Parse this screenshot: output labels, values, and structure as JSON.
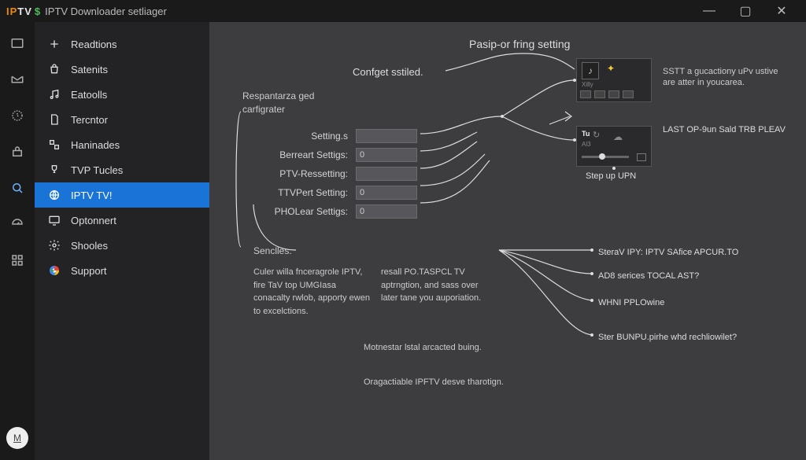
{
  "brand": {
    "iptv": "IPTV",
    "dollar": "$",
    "title": "IPTV Downloader setliager"
  },
  "window_controls": {
    "minimize": "—",
    "maximize": "▢",
    "close": "✕"
  },
  "rail": {
    "items": [
      "browse",
      "mail",
      "history",
      "library",
      "search-active",
      "dashboard",
      "apps"
    ],
    "avatar": "M"
  },
  "sidebar": {
    "items": [
      {
        "icon": "+",
        "label": "Readtions"
      },
      {
        "icon": "bag",
        "label": "Satenits"
      },
      {
        "icon": "note",
        "label": "Eatoolls"
      },
      {
        "icon": "page",
        "label": "Tercntor"
      },
      {
        "icon": "tile",
        "label": "Haninades"
      },
      {
        "icon": "cup",
        "label": "TVP Tucles"
      },
      {
        "icon": "globe",
        "label": "IPTV TV!",
        "active": true
      },
      {
        "icon": "screen",
        "label": "Optonnert"
      },
      {
        "icon": "gear",
        "label": "Shooles"
      },
      {
        "icon": "chrome",
        "label": "Support"
      }
    ]
  },
  "main": {
    "page_title": "Pasip-or fring setting",
    "conf_subtitle": "Confget sstiled.",
    "section_label": "Respantarza ged carfigrater",
    "settings": [
      {
        "label": "Setting.s",
        "value": ""
      },
      {
        "label": "Berreart Settigs:",
        "value": "0"
      },
      {
        "label": "PTV-Ressetting:",
        "value": ""
      },
      {
        "label": "TTVPert Setting:",
        "value": "0"
      },
      {
        "label": "PHOLear Settigs:",
        "value": "0"
      }
    ],
    "sencles_label": "Senclles.",
    "para1a": "Culer willa fnceragrole IPTV, fire TaV top UMGIasa conacalty rwlob, apporty ewen to excelctions.",
    "para1b": "resall PO.TASPCL TV aptrngtion, and sass over later tane you auporiation.",
    "para2": "Motnestar lstal arcacted buing.",
    "para3": "Oragactiable IPFTV desve tharotign.",
    "preview1_sub": "Xilly",
    "preview2_tu": "Tu",
    "preview2_ln": "Al3",
    "caption_sstt": "SSTT\na gucactiony uPv ustive are atter in youcarea.",
    "caption_last": "LAST OP-9un Sald TRB PLEAV",
    "caption_step": "Step up UPN",
    "notes": [
      "SteraV IPY:  IPTV SAfice APCUR.TO",
      "AD8 serices TOCAL AST?",
      "WHNI PPLOwine",
      "Ster BUNPU.pirhe whd rechliowilet?"
    ]
  }
}
